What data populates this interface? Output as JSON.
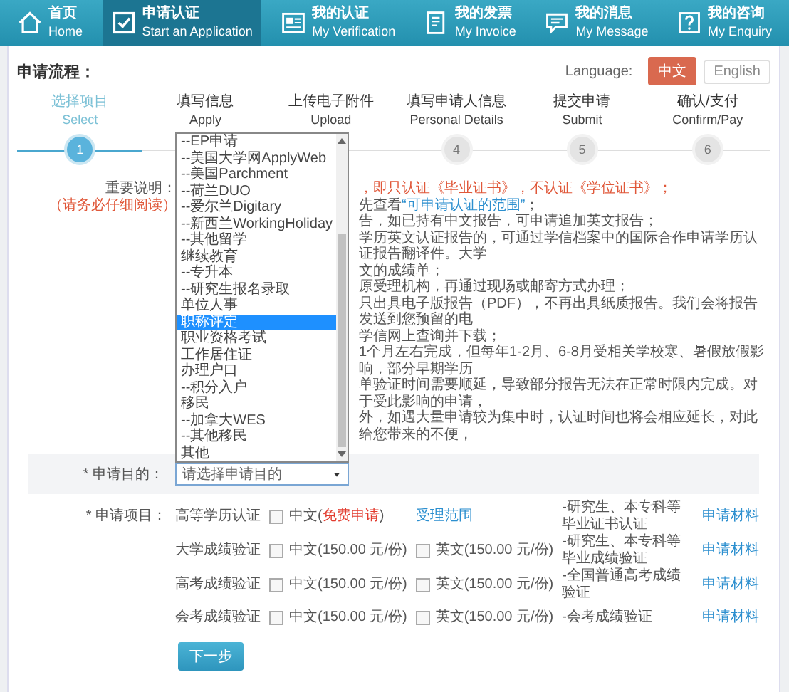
{
  "nav": [
    {
      "title": "首页",
      "subtitle": "Home",
      "selected": false
    },
    {
      "title": "申请认证",
      "subtitle": "Start an Application",
      "selected": true
    },
    {
      "title": "我的认证",
      "subtitle": "My Verification",
      "selected": false
    },
    {
      "title": "我的发票",
      "subtitle": "My Invoice",
      "selected": false
    },
    {
      "title": "我的消息",
      "subtitle": "My Message",
      "selected": false
    },
    {
      "title": "我的咨询",
      "subtitle": "My Enquiry",
      "selected": false
    }
  ],
  "header": {
    "title": "申请流程：",
    "language_label": "Language:",
    "languages": [
      {
        "label": "中文",
        "selected": true
      },
      {
        "label": "English",
        "selected": false
      }
    ]
  },
  "steps": [
    {
      "title": "选择项目",
      "subtitle": "Select",
      "number": "1",
      "selected": true
    },
    {
      "title": "填写信息",
      "subtitle": "Apply",
      "selected": false
    },
    {
      "title": "上传电子附件",
      "subtitle": "Upload",
      "selected": false
    },
    {
      "title": "填写申请人信息",
      "subtitle": "Personal Details",
      "number": "4",
      "selected": false
    },
    {
      "title": "提交申请",
      "subtitle": "Submit",
      "number": "5",
      "selected": false
    },
    {
      "title": "确认/支付",
      "subtitle": "Confirm/Pay",
      "number": "6",
      "selected": false
    }
  ],
  "notice": {
    "label": "重要说明：",
    "hint": "（请务必仔细阅读）",
    "lines": [
      [
        {
          "kind": "warning",
          "text": "，即只认证《毕业证书》，不认证《学位证书》；"
        }
      ],
      [
        {
          "kind": "plain",
          "text": "先查看"
        },
        {
          "kind": "link",
          "text": "“可申请认证的范围”"
        },
        {
          "kind": "plain",
          "text": "；"
        }
      ],
      [
        {
          "kind": "plain",
          "text": "告，如已持有中文报告，可申请追加英文报告；"
        }
      ],
      [
        {
          "kind": "plain",
          "text": "学历英文认证报告的，可通过学信档案中的国际合作申请学历认证报告翻译件。大学"
        }
      ],
      [
        {
          "kind": "plain",
          "text": "文的成绩单；"
        }
      ],
      [
        {
          "kind": "plain",
          "text": "原受理机构，再通过现场或邮寄方式办理；"
        }
      ],
      [
        {
          "kind": "plain",
          "text": "只出具电子版报告（PDF），不再出具纸质报告。我们会将报告发送到您预留的电"
        }
      ],
      [
        {
          "kind": "plain",
          "text": "学信网上查询并下载；"
        }
      ],
      [
        {
          "kind": "plain",
          "text": "1个月左右完成，但每年1-2月、6-8月受相关学校寒、暑假放假影响，部分早期学历"
        }
      ],
      [
        {
          "kind": "plain",
          "text": "单验证时间需要顺延，导致部分报告无法在正常时限内完成。对于受此影响的申请，"
        }
      ],
      [
        {
          "kind": "plain",
          "text": "外，如遇大量申请较为集中时，认证时间也将会相应延长，对此给您带来的不便，"
        }
      ]
    ]
  },
  "purpose": {
    "label": "* 申请目的：",
    "select": {
      "placeholder": "请选择申请目的",
      "expanded": true
    },
    "options": [
      {
        "label": "--EP申请",
        "selected": false
      },
      {
        "label": "--美国大学网ApplyWeb",
        "selected": false
      },
      {
        "label": "--美国Parchment",
        "selected": false
      },
      {
        "label": "--荷兰DUO",
        "selected": false
      },
      {
        "label": "--爱尔兰Digitary",
        "selected": false
      },
      {
        "label": "--新西兰WorkingHoliday",
        "selected": false
      },
      {
        "label": "--其他留学",
        "selected": false
      },
      {
        "label": "继续教育",
        "selected": false
      },
      {
        "label": "--专升本",
        "selected": false
      },
      {
        "label": "--研究生报名录取",
        "selected": false
      },
      {
        "label": "单位人事",
        "selected": false
      },
      {
        "label": "职称评定",
        "selected": true
      },
      {
        "label": "职业资格考试",
        "selected": false
      },
      {
        "label": "工作居住证",
        "selected": false
      },
      {
        "label": "办理户口",
        "selected": false
      },
      {
        "label": "--积分入户",
        "selected": false
      },
      {
        "label": "移民",
        "selected": false
      },
      {
        "label": "--加拿大WES",
        "selected": false
      },
      {
        "label": "--其他移民",
        "selected": false
      },
      {
        "label": "其他",
        "selected": false
      }
    ]
  },
  "items": {
    "label": "* 申请项目：",
    "rows": [
      {
        "name": "高等学历认证",
        "options": [
          {
            "label": "中文(",
            "highlight": "免费申请",
            "label_end": ")",
            "checked": false
          }
        ],
        "link": "受理范围",
        "description": "-研究生、本专科等毕业证书认证",
        "material": "申请材料"
      },
      {
        "name": "大学成绩验证",
        "options": [
          {
            "label": "中文(150.00 元/份)",
            "checked": false
          },
          {
            "label": "英文(150.00 元/份)",
            "checked": false
          }
        ],
        "description": "-研究生、本专科等毕业成绩验证",
        "material": "申请材料"
      },
      {
        "name": "高考成绩验证",
        "options": [
          {
            "label": "中文(150.00 元/份)",
            "checked": false
          },
          {
            "label": "英文(150.00 元/份)",
            "checked": false
          }
        ],
        "description": "-全国普通高考成绩验证",
        "material": "申请材料"
      },
      {
        "name": "会考成绩验证",
        "options": [
          {
            "label": "中文(150.00 元/份)",
            "checked": false
          },
          {
            "label": "英文(150.00 元/份)",
            "checked": false
          }
        ],
        "description": "-会考成绩验证",
        "material": "申请材料"
      }
    ]
  },
  "next_button": "下一步"
}
